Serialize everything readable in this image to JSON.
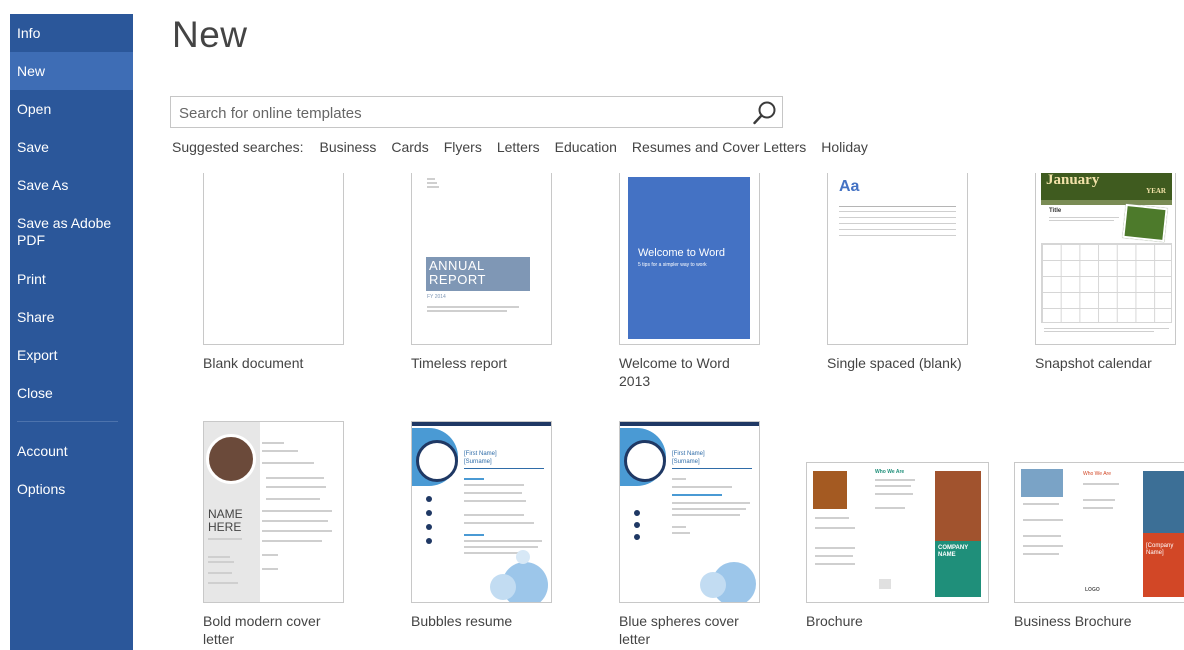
{
  "sidebar": {
    "items": [
      {
        "label": "Info"
      },
      {
        "label": "New"
      },
      {
        "label": "Open"
      },
      {
        "label": "Save"
      },
      {
        "label": "Save As"
      },
      {
        "label": "Save as Adobe PDF"
      },
      {
        "label": "Print"
      },
      {
        "label": "Share"
      },
      {
        "label": "Export"
      },
      {
        "label": "Close"
      },
      {
        "label": "Account"
      },
      {
        "label": "Options"
      }
    ]
  },
  "main": {
    "title": "New",
    "search": {
      "placeholder": "Search for online templates",
      "value": ""
    },
    "suggested": {
      "label": "Suggested searches:",
      "links": [
        "Business",
        "Cards",
        "Flyers",
        "Letters",
        "Education",
        "Resumes and Cover Letters",
        "Holiday"
      ]
    },
    "templates": [
      {
        "name": "Blank document"
      },
      {
        "name": "Timeless report"
      },
      {
        "name": "Welcome to Word 2013"
      },
      {
        "name": "Single spaced (blank)"
      },
      {
        "name": "Snapshot calendar"
      },
      {
        "name": "Bold modern cover letter"
      },
      {
        "name": "Bubbles resume"
      },
      {
        "name": "Blue spheres cover letter"
      },
      {
        "name": "Brochure"
      },
      {
        "name": "Business Brochure"
      }
    ],
    "thumb_text": {
      "annual_report": "ANNUAL REPORT",
      "fy": "FY 2014",
      "welcome_title": "Welcome to Word",
      "welcome_sub": "5 tips for a simpler way to work",
      "aa": "Aa",
      "calendar_month": "January",
      "calendar_year": "YEAR",
      "calendar_title": "Title",
      "name_here": "NAME HERE",
      "first_name": "[First Name]",
      "surname": "[Surname]",
      "company_name": "COMPANY NAME",
      "company_name_bracket": "[Company Name]",
      "who_we_are": "Who We Are",
      "logo": "LOGO"
    }
  },
  "colors": {
    "sidebar": "#2b579a",
    "sidebar_active": "#3e6db5",
    "word_blue": "#4472c4",
    "teal": "#1f8f7a",
    "orange_red": "#d24726",
    "resume_navy": "#1f3864",
    "resume_blue": "#4a9ad4"
  }
}
